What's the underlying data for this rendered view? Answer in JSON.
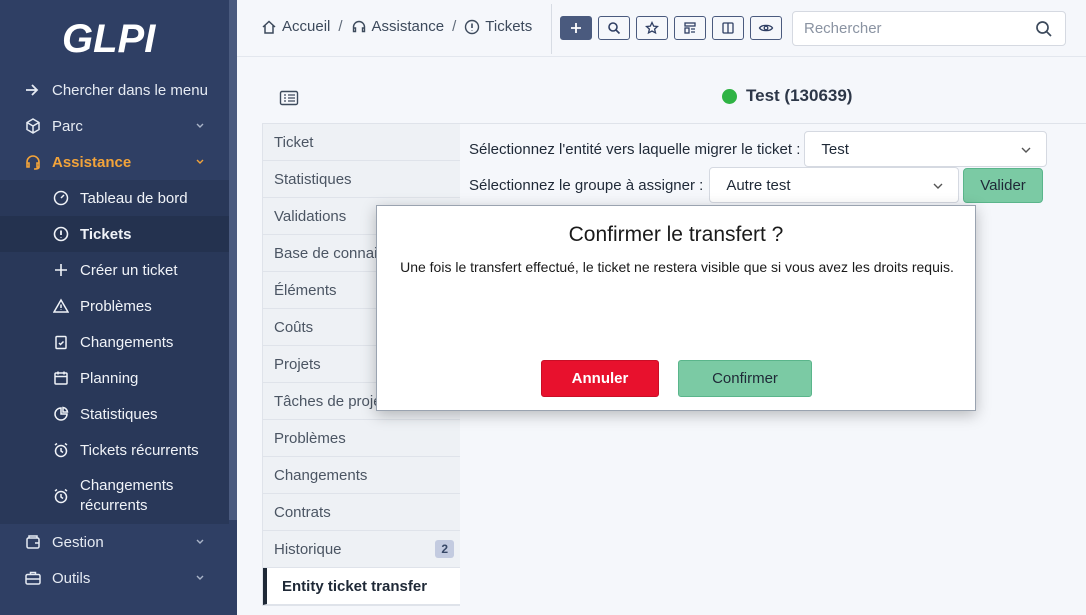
{
  "app": {
    "logo_text": "GLPI"
  },
  "sidebar": {
    "items": [
      {
        "label": "Chercher dans le menu",
        "icon": "arrow-right-icon"
      },
      {
        "label": "Parc",
        "icon": "box-icon",
        "expandable": true
      },
      {
        "label": "Assistance",
        "icon": "headset-icon",
        "expandable": true,
        "active": true
      }
    ],
    "submenu": [
      {
        "label": "Tableau de bord",
        "icon": "dashboard-icon"
      },
      {
        "label": "Tickets",
        "icon": "alert-circle-icon",
        "current": true
      },
      {
        "label": "Créer un ticket",
        "icon": "plus-icon"
      },
      {
        "label": "Problèmes",
        "icon": "alert-triangle-icon"
      },
      {
        "label": "Changements",
        "icon": "clipboard-check-icon"
      },
      {
        "label": "Planning",
        "icon": "calendar-icon"
      },
      {
        "label": "Statistiques",
        "icon": "pie-chart-icon"
      },
      {
        "label": "Tickets récurrents",
        "icon": "alarm-icon"
      },
      {
        "label": "Changements récurrents",
        "icon": "alarm-icon"
      }
    ],
    "bottom_items": [
      {
        "label": "Gestion",
        "icon": "wallet-icon",
        "expandable": true
      },
      {
        "label": "Outils",
        "icon": "briefcase-icon",
        "expandable": true
      }
    ]
  },
  "header": {
    "breadcrumb": [
      {
        "label": "Accueil",
        "icon": "home-icon"
      },
      {
        "label": "Assistance",
        "icon": "headset-icon"
      },
      {
        "label": "Tickets",
        "icon": "alert-circle-icon"
      }
    ],
    "toolbar": [
      "plus-icon",
      "search-icon",
      "star-icon",
      "template-icon",
      "columns-icon",
      "eye-icon"
    ],
    "search": {
      "placeholder": "Rechercher",
      "value": ""
    }
  },
  "item": {
    "title": "Test (130639)",
    "status_color": "#2fb344"
  },
  "tabs": [
    {
      "label": "Ticket"
    },
    {
      "label": "Statistiques"
    },
    {
      "label": "Validations"
    },
    {
      "label": "Base de connai"
    },
    {
      "label": "Éléments"
    },
    {
      "label": "Coûts"
    },
    {
      "label": "Projets"
    },
    {
      "label": "Tâches de proje"
    },
    {
      "label": "Problèmes"
    },
    {
      "label": "Changements"
    },
    {
      "label": "Contrats"
    },
    {
      "label": "Historique",
      "badge": "2"
    },
    {
      "label": "Entity ticket transfer",
      "active": true
    }
  ],
  "form": {
    "entity_label": "Sélectionnez l'entité vers laquelle migrer le ticket :",
    "entity_value": "Test",
    "group_label": "Sélectionnez le groupe à assigner :",
    "group_value": "Autre test",
    "submit_label": "Valider"
  },
  "modal": {
    "title": "Confirmer le transfert ?",
    "message": "Une fois le transfert effectué, le ticket ne restera visible que si vous avez les droits requis.",
    "cancel_label": "Annuler",
    "confirm_label": "Confirmer"
  },
  "colors": {
    "sidebar_bg": "#2f3f64",
    "accent": "#f2a33a",
    "success": "#7bcaa4",
    "danger": "#e8112d"
  }
}
